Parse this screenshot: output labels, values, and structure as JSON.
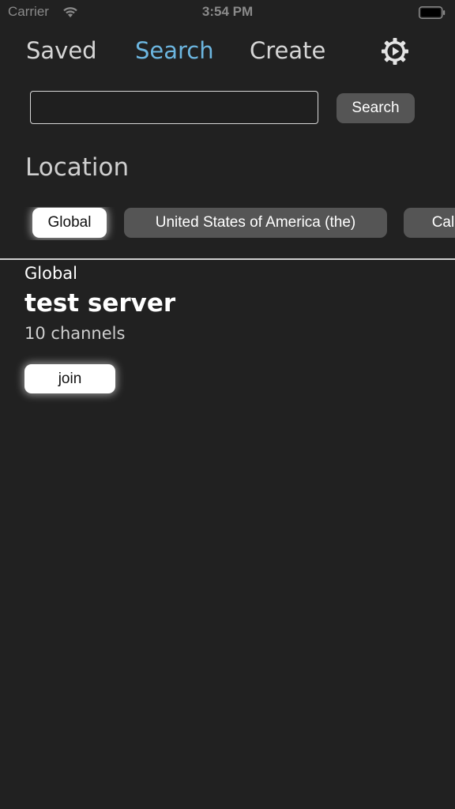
{
  "status_bar": {
    "carrier": "Carrier",
    "time": "3:54 PM",
    "wifi_icon": "wifi-icon",
    "battery_icon": "battery-icon"
  },
  "nav": {
    "tabs": [
      {
        "label": "Saved",
        "active": false
      },
      {
        "label": "Search",
        "active": true
      },
      {
        "label": "Create",
        "active": false
      }
    ],
    "settings_icon": "gear-icon",
    "active_color": "#6cb6e0"
  },
  "search": {
    "value": "",
    "placeholder": "",
    "button_label": "Search"
  },
  "location": {
    "heading": "Location",
    "chips": [
      {
        "label": "Global",
        "selected": true
      },
      {
        "label": "United States of America (the)",
        "selected": false
      },
      {
        "label": "Califo",
        "selected": false
      }
    ]
  },
  "results": [
    {
      "location": "Global",
      "title": "test server",
      "subtitle": "10 channels",
      "join_label": "join"
    }
  ],
  "colors": {
    "background": "#212121",
    "chip_unselected": "#555555",
    "chip_selected": "#ffffff"
  }
}
